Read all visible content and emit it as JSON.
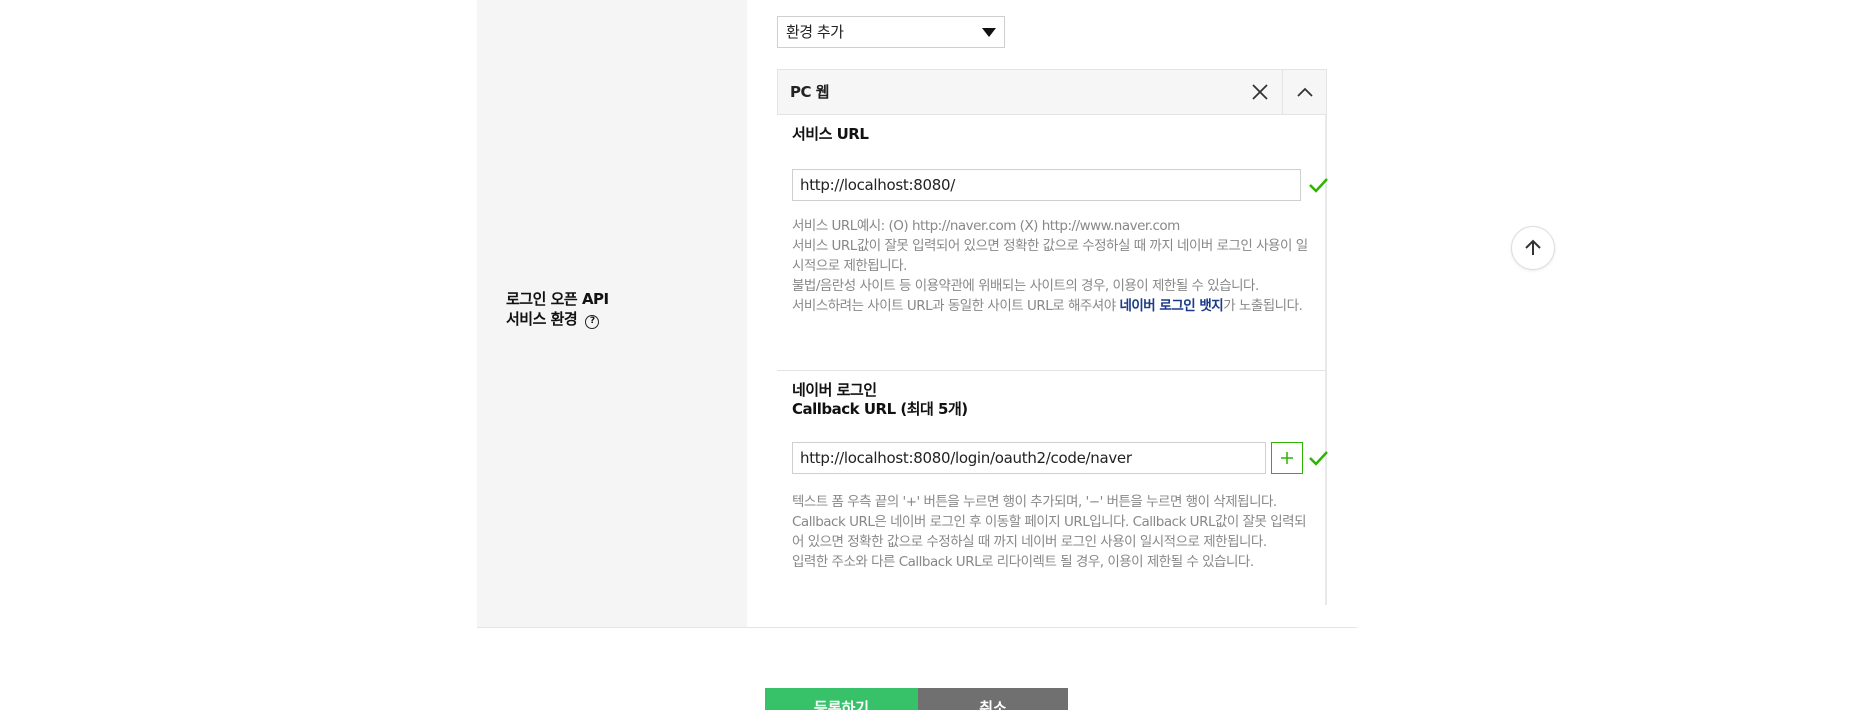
{
  "form": {
    "field_label_line1": "로그인 오픈 API",
    "field_label_line2": "서비스 환경",
    "help_icon": "question-circle-icon",
    "env_select": {
      "selected": "환경 추가",
      "icon": "caret-down-icon"
    }
  },
  "panel": {
    "title": "PC 웹",
    "close_icon": "close-icon",
    "collapse_icon": "chevron-up-icon",
    "service_url": {
      "title": "서비스 URL",
      "value": "http://localhost:8080/",
      "status_icon": "check-icon",
      "desc": [
        "서비스 URL예시: (O) http://naver.com (X) http://www.naver.com",
        "서비스 URL값이 잘못 입력되어 있으면 정확한 값으로 수정하실 때 까지 네이버 로그인 사용이 일시적으로 제한됩니다.",
        "불법/음란성 사이트 등 이용약관에 위배되는 사이트의 경우, 이용이 제한될 수 있습니다."
      ],
      "desc_badge_pre": "서비스하려는 사이트 URL과 동일한 사이트 URL로 해주셔야 ",
      "desc_badge_strong": "네이버 로그인 뱃지",
      "desc_badge_post": "가 노출됩니다."
    },
    "callback_url": {
      "title_line1": "네이버 로그인",
      "title_line2": "Callback URL (최대 5개)",
      "value": "http://localhost:8080/login/oauth2/code/naver",
      "add_icon": "plus-icon",
      "status_icon": "check-icon",
      "desc": [
        "텍스트 폼 우측 끝의 '+' 버튼을 누르면 행이 추가되며, '−' 버튼을 누르면 행이 삭제됩니다.",
        "Callback URL은 네이버 로그인 후 이동할 페이지 URL입니다. Callback URL값이 잘못 입력되어 있으면 정확한 값으로 수정하실 때 까지 네이버 로그인 사용이 일시적으로 제한됩니다.",
        "입력한 주소와 다른 Callback URL로 리다이렉트 될 경우, 이용이 제한될 수 있습니다."
      ]
    }
  },
  "scroll_top_icon": "arrow-up-icon",
  "actions": {
    "register": "등록하기",
    "cancel": "취소"
  },
  "colors": {
    "accent_green": "#2db400",
    "button_green": "#37c26a",
    "button_gray": "#707070",
    "badge_link": "#1b3a8a"
  }
}
